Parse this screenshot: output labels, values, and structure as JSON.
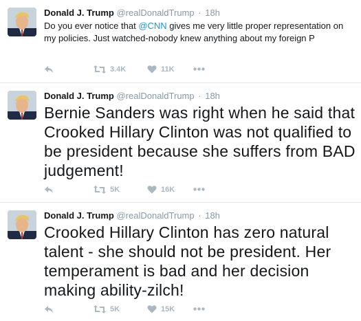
{
  "tweets": [
    {
      "name": "Donald J. Trump",
      "handle": "@realDonaldTrump",
      "dot": "·",
      "time": "18h",
      "text_before": "Do you ever notice that ",
      "mention": "@CNN",
      "text_after": " gives me very little proper representation on my policies. Just watched-nobody knew anything about my foreign P",
      "retweets": "3.4K",
      "likes": "11K"
    },
    {
      "name": "Donald J. Trump",
      "handle": "@realDonaldTrump",
      "dot": "·",
      "time": "18h",
      "text": "Bernie Sanders was right when he said that Crooked Hillary Clinton was not qualified to be president because she suffers from BAD judgement!",
      "retweets": "5K",
      "likes": "16K"
    },
    {
      "name": "Donald J. Trump",
      "handle": "@realDonaldTrump",
      "dot": "·",
      "time": "18h",
      "text": "Crooked Hillary Clinton has zero natural talent - she should not be president. Her temperament is bad and her decision making ability-zilch!",
      "retweets": "5K",
      "likes": "15K"
    }
  ],
  "icons": {
    "reply": "reply-icon",
    "retweet": "retweet-icon",
    "like": "heart-icon",
    "more": "more-dots-icon"
  },
  "colors": {
    "accent": "#1b95e0",
    "muted": "#8899a6",
    "icon": "#aab8c2",
    "divider": "#e1e8ed"
  }
}
